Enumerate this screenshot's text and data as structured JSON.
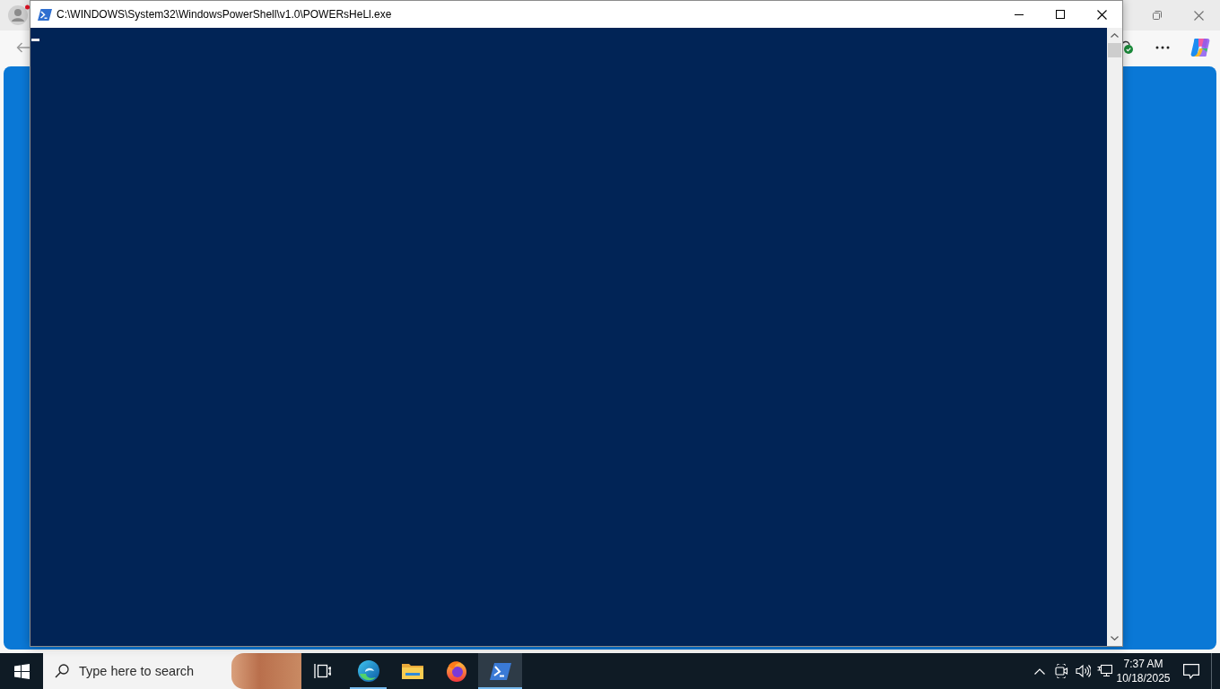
{
  "console_window": {
    "title": "C:\\WINDOWS\\System32\\WindowsPowerShell\\v1.0\\POWERsHeLl.exe"
  },
  "taskbar": {
    "search": {
      "placeholder": "Type here to search"
    },
    "apps": [
      {
        "kind": "edge",
        "running": true,
        "selected": false
      },
      {
        "kind": "explorer",
        "running": false,
        "selected": false
      },
      {
        "kind": "firefox",
        "running": false,
        "selected": false
      },
      {
        "kind": "powershell",
        "running": true,
        "selected": true
      }
    ],
    "clock": {
      "time": "7:37 AM",
      "date": "10/18/2025"
    }
  }
}
